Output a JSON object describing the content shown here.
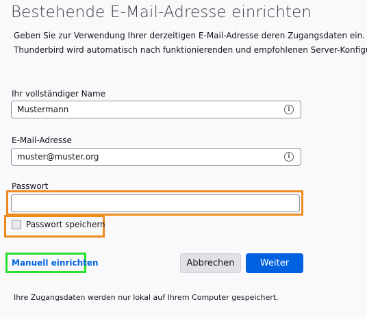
{
  "page": {
    "title": "Bestehende E-Mail-Adresse einrichten",
    "description": [
      "Geben Sie zur Verwendung Ihrer derzeitigen E-Mail-Adresse deren Zugangsdaten ein.",
      "Thunderbird wird automatisch nach funktionierenden und empfohlenen Server-Konfigura"
    ]
  },
  "form": {
    "name": {
      "label": "Ihr vollständiger Name",
      "value": "Mustermann",
      "info_icon": "info-icon"
    },
    "email": {
      "label": "E-Mail-Adresse",
      "value": "muster@muster.org",
      "info_icon": "info-icon"
    },
    "password": {
      "label": "Passwort",
      "value": ""
    },
    "remember_password": {
      "label": "Passwort speichern",
      "checked": false
    }
  },
  "actions": {
    "manual_setup": "Manuell einrichten",
    "cancel": "Abbrechen",
    "continue": "Weiter"
  },
  "footer": {
    "note": "Ihre Zugangsdaten werden nur lokal auf Ihrem Computer gespeichert."
  },
  "colors": {
    "accent": "#0061e0",
    "highlight_orange": "#ef8a1c",
    "highlight_green": "#28e12a"
  }
}
